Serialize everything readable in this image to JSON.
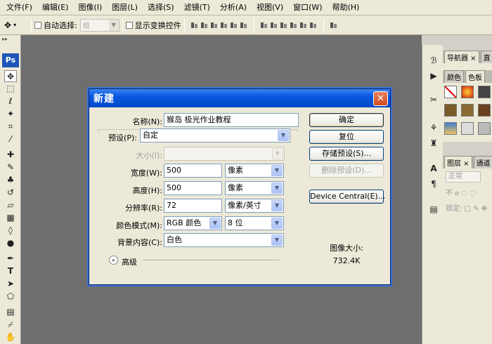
{
  "menu": [
    "文件(F)",
    "编辑(E)",
    "图像(I)",
    "图层(L)",
    "选择(S)",
    "滤镜(T)",
    "分析(A)",
    "视图(V)",
    "窗口(W)",
    "帮助(H)"
  ],
  "options_bar": {
    "auto_select_label": "自动选择:",
    "auto_select_value": "组",
    "show_transform_label": "显示变换控件"
  },
  "toolbox": {
    "logo": "Ps"
  },
  "right_panels": {
    "tab_navigator": "导航器",
    "tab_histogram": "直",
    "tab_color": "颜色",
    "tab_swatches": "色板",
    "tab_layers": "图层",
    "tab_channels": "通道",
    "blend_mode": "正常",
    "lock_label": "锁定:"
  },
  "dialog": {
    "title": "新建",
    "name_label": "名称(N):",
    "name_value": "猴岛 极光作业教程",
    "preset_label": "预设(P):",
    "preset_value": "自定",
    "size_label": "大小(I):",
    "width_label": "宽度(W):",
    "width_value": "500",
    "width_unit": "像素",
    "height_label": "高度(H):",
    "height_value": "500",
    "height_unit": "像素",
    "resolution_label": "分辨率(R):",
    "resolution_value": "72",
    "resolution_unit": "像素/英寸",
    "color_mode_label": "颜色模式(M):",
    "color_mode_value": "RGB 颜色",
    "bit_depth_value": "8 位",
    "background_label": "背景内容(C):",
    "background_value": "白色",
    "advanced_label": "高级",
    "ok_label": "确定",
    "reset_label": "复位",
    "save_preset_label": "存储预设(S)...",
    "delete_preset_label": "删除预设(D)...",
    "device_central_label": "Device Central(E)...",
    "image_size_label": "图像大小:",
    "image_size_value": "732.4K"
  },
  "colors": {
    "titlebar": "#0857e0",
    "workspace": "#6e6e6e",
    "chrome": "#ece9d8",
    "close_button": "#d24a20"
  }
}
